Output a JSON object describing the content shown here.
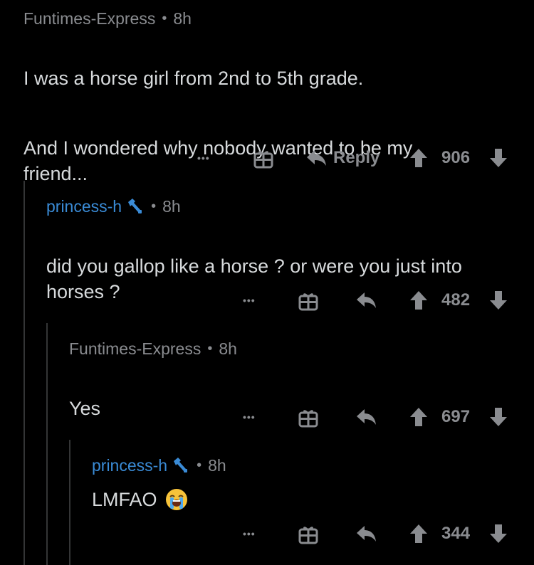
{
  "colors": {
    "background": "#000000",
    "text": "#d7dadc",
    "muted": "#8a8c90",
    "op_blue": "#3a8bd6",
    "thread": "#343536"
  },
  "comments": [
    {
      "author": "Funtimes-Express",
      "age": "8h",
      "paragraphs": [
        "I was a horse girl from 2nd to 5th grade.",
        "And I wondered why nobody wanted to be my friend..."
      ],
      "reply_label": "Reply",
      "score": "906"
    },
    {
      "author": "princess-h",
      "age": "8h",
      "badge_icon": "mod-wrench-icon",
      "paragraphs": [
        "did you gallop like a horse ? or were you just into horses ?"
      ],
      "score": "482"
    },
    {
      "author": "Funtimes-Express",
      "age": "8h",
      "paragraphs": [
        "Yes"
      ],
      "score": "697"
    },
    {
      "author": "princess-h",
      "age": "8h",
      "badge_icon": "mod-wrench-icon",
      "paragraphs": [
        "LMFAO"
      ],
      "emoji": "loudly-crying-face-emoji",
      "score": "344"
    }
  ],
  "dot_separator": "•",
  "more_glyph": "•••"
}
